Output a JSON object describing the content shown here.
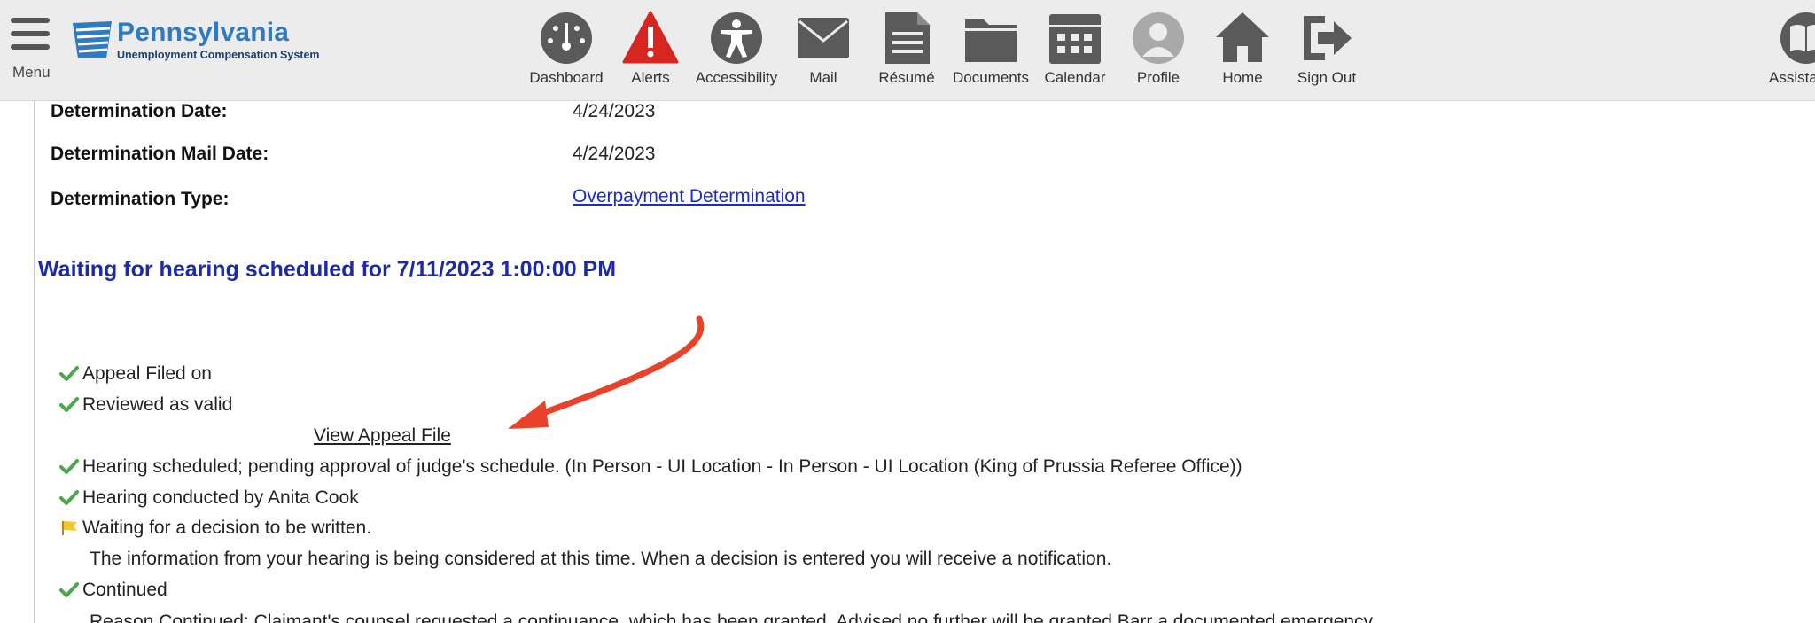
{
  "header": {
    "menu_label": "Menu",
    "logo_title": "Pennsylvania",
    "logo_subtitle": "Unemployment Compensation System",
    "nav": [
      {
        "label": "Dashboard",
        "icon": "dashboard-icon"
      },
      {
        "label": "Alerts",
        "icon": "alert-icon"
      },
      {
        "label": "Accessibility",
        "icon": "accessibility-icon"
      },
      {
        "label": "Mail",
        "icon": "mail-icon"
      },
      {
        "label": "Résumé",
        "icon": "resume-icon"
      },
      {
        "label": "Documents",
        "icon": "folder-icon"
      },
      {
        "label": "Calendar",
        "icon": "calendar-icon"
      },
      {
        "label": "Profile",
        "icon": "profile-icon"
      },
      {
        "label": "Home",
        "icon": "home-icon"
      },
      {
        "label": "Sign Out",
        "icon": "sign-out-icon"
      }
    ],
    "assistance_label": "Assista"
  },
  "determination": {
    "date_label": "Determination Date:",
    "date_value": "4/24/2023",
    "mail_date_label": "Determination Mail Date:",
    "mail_date_value": "4/24/2023",
    "type_label": "Determination Type:",
    "type_value": "Overpayment Determination"
  },
  "status_heading": "Waiting for hearing scheduled for 7/11/2023 1:00:00 PM",
  "timeline": {
    "appeal_filed": "Appeal Filed on",
    "reviewed": "Reviewed as valid",
    "view_appeal_link": "View Appeal File",
    "hearing_scheduled": "Hearing scheduled; pending approval of judge's schedule. (In Person - UI Location - In Person - UI Location (King of Prussia Referee Office))",
    "hearing_conducted": "Hearing conducted by Anita Cook",
    "waiting_decision": "Waiting for a decision to be written.",
    "waiting_note": "The information from your hearing is being considered at this time. When a decision is entered you will receive a notification.",
    "continued": "Continued",
    "continued_note": "Reason Continued: Claimant's counsel requested a continuance, which has been granted. Advised no further will be granted Barr a documented emergency."
  },
  "colors": {
    "link": "#1a2bd0",
    "heading": "#1d2aa8",
    "check": "#4aa84a",
    "arrow": "#e8432a",
    "alert_red": "#d6261f"
  }
}
